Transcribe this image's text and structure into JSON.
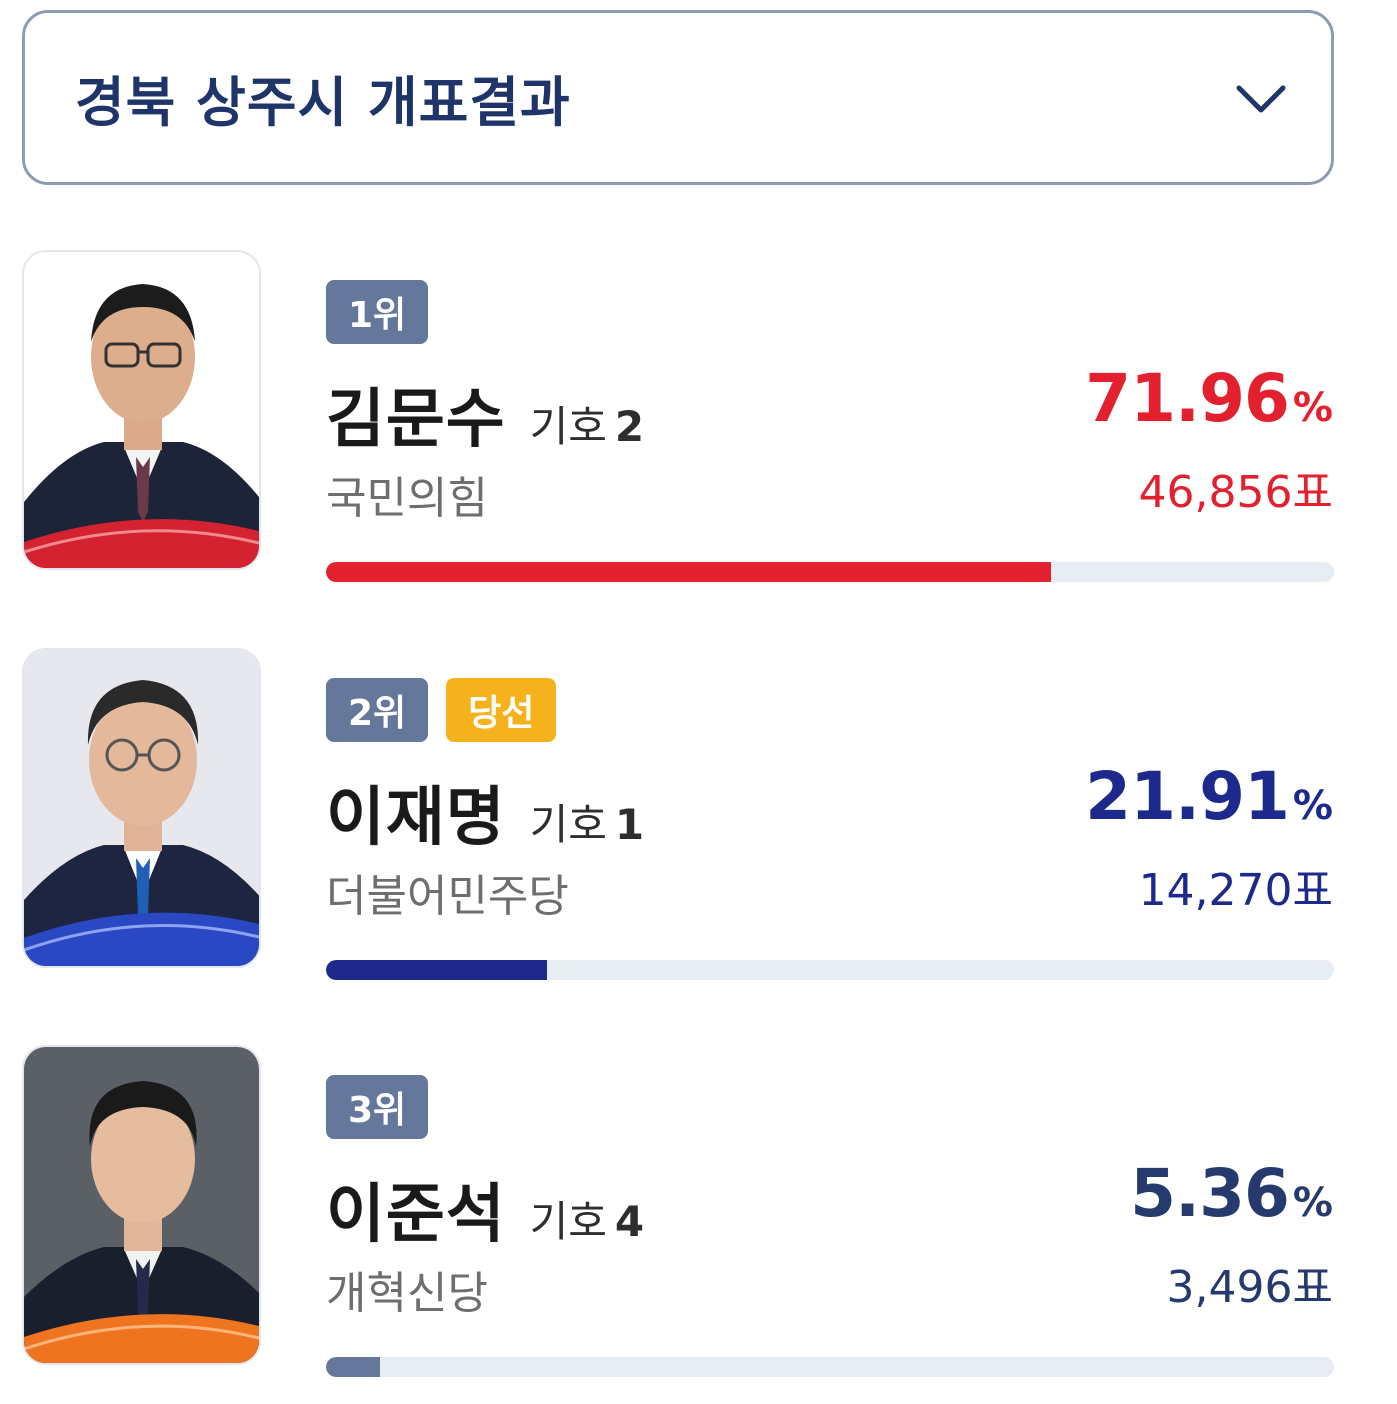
{
  "header": {
    "title": "경북 상주시 개표결과"
  },
  "candidates": [
    {
      "rank": "1위",
      "won_badge": "",
      "name": "김문수",
      "symbol_label": "기호",
      "symbol_number": "2",
      "party": "국민의힘",
      "percent": "71.96",
      "percent_unit": "%",
      "votes": "46,856표",
      "share": 0.7196,
      "color": "#e3202e",
      "ribbon_color": "#d42231",
      "photo_bg": "#ffffff"
    },
    {
      "rank": "2위",
      "won_badge": "당선",
      "name": "이재명",
      "symbol_label": "기호",
      "symbol_number": "1",
      "party": "더불어민주당",
      "percent": "21.91",
      "percent_unit": "%",
      "votes": "14,270표",
      "share": 0.2191,
      "color": "#1d2a8c",
      "ribbon_color": "#2a47c4",
      "photo_bg": "#e6e8ee"
    },
    {
      "rank": "3위",
      "won_badge": "",
      "name": "이준석",
      "symbol_label": "기호",
      "symbol_number": "4",
      "party": "개혁신당",
      "percent": "5.36",
      "percent_unit": "%",
      "votes": "3,496표",
      "share": 0.0536,
      "color": "#273a6e",
      "bar_color": "#66779c",
      "ribbon_color": "#ee7420",
      "photo_bg": "#5b5f66"
    }
  ],
  "icons": {
    "dropdown": "chevron-down-icon"
  }
}
